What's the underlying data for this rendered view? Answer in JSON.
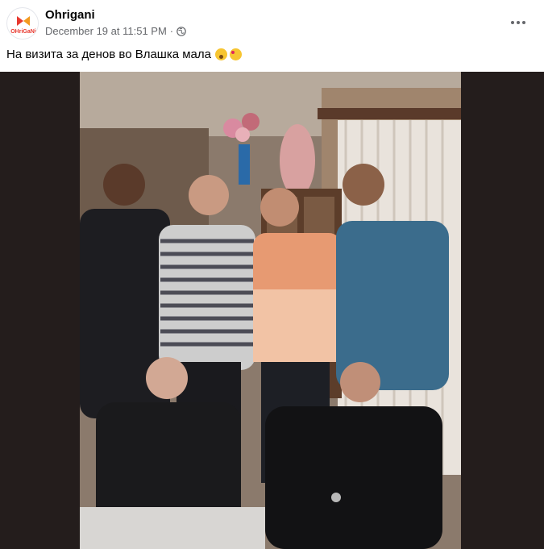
{
  "post": {
    "page_name": "Ohrigani",
    "logo_text": "OHriGaNi",
    "date": "December 19 at 11:51 PM",
    "separator": "·",
    "caption": "На визита за денов во Влашка мала",
    "caption_emojis": [
      "astonished-face",
      "smiling-face-with-hearts"
    ]
  },
  "icons": {
    "privacy": "globe-icon",
    "menu": "more-options-icon"
  },
  "photo": {
    "subject": "six-people-standing-in-living-room"
  },
  "colors": {
    "photo_background": "#241d1c",
    "meta_text": "#65676b",
    "logo_red": "#e8392f",
    "logo_orange": "#f39a1f"
  }
}
